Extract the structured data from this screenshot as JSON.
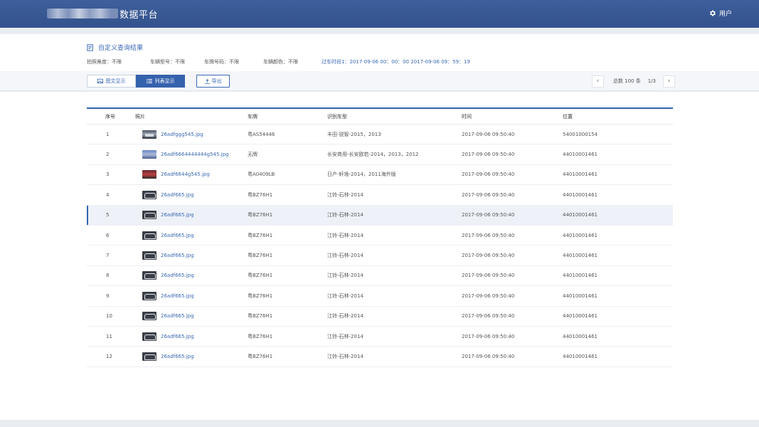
{
  "header": {
    "title": "数据平台",
    "user_label": "用户"
  },
  "query": {
    "title": "自定义查询结果",
    "filters": {
      "angle": "拍照角度：不限",
      "model": "车辆型号：不限",
      "plate": "车牌号码：不限",
      "color": "车辆颜色：不限",
      "time": "过车时段1：2017-09-06 00：00：00  2017-09-06  09：59：19"
    }
  },
  "toolbar": {
    "tab_graphic": "图文显示",
    "tab_list": "列表显示",
    "export": "导出",
    "total": "总数 100 条",
    "page": "1/3",
    "prev": "‹",
    "next": "›"
  },
  "table": {
    "columns": [
      "序号",
      "照片",
      "车牌",
      "识别车型",
      "时间",
      "位置"
    ],
    "rows": [
      {
        "idx": "1",
        "photo": "26adfggg545.jpg",
        "thumb": "car",
        "plate": "粤AS54446",
        "type": "丰田-锐智-2015，2013",
        "time": "2017-09-06   09:50:40",
        "loc": "54001000154"
      },
      {
        "idx": "2",
        "photo": "26adf6664444444g545.jpg",
        "thumb": "blue",
        "plate": "无牌",
        "type": "长安商用-长安欧若-2014，2013，2012",
        "time": "2017-09-06   09:50:40",
        "loc": "44010001461"
      },
      {
        "idx": "3",
        "photo": "26adf6644g545.jpg",
        "thumb": "red",
        "plate": "粤A0409LB",
        "type": "日产-轩逸-2014，2011海外版",
        "time": "2017-09-06   09:50:40",
        "loc": "44010001461"
      },
      {
        "idx": "4",
        "photo": "26adf665.jpg",
        "thumb": "logo",
        "plate": "粤BZ76H1",
        "type": "江铃-石林-2014",
        "time": "2017-09-06   09:50:40",
        "loc": "44010001461"
      },
      {
        "idx": "5",
        "photo": "26adf665.jpg",
        "thumb": "logo",
        "plate": "粤BZ76H1",
        "type": "江铃-石林-2014",
        "time": "2017-09-06   09:50:40",
        "loc": "44010001461"
      },
      {
        "idx": "6",
        "photo": "26adf665.jpg",
        "thumb": "logo",
        "plate": "粤BZ76H1",
        "type": "江铃-石林-2014",
        "time": "2017-09-06   09:50:40",
        "loc": "44010001461"
      },
      {
        "idx": "7",
        "photo": "26adf665.jpg",
        "thumb": "logo",
        "plate": "粤BZ76H1",
        "type": "江铃-石林-2014",
        "time": "2017-09-06   09:50:40",
        "loc": "44010001461"
      },
      {
        "idx": "8",
        "photo": "26adf665.jpg",
        "thumb": "logo",
        "plate": "粤BZ76H1",
        "type": "江铃-石林-2014",
        "time": "2017-09-06   09:50:40",
        "loc": "44010001461"
      },
      {
        "idx": "9",
        "photo": "26adf665.jpg",
        "thumb": "logo",
        "plate": "粤BZ76H1",
        "type": "江铃-石林-2014",
        "time": "2017-09-06   09:50:40",
        "loc": "44010001461"
      },
      {
        "idx": "10",
        "photo": "26adf665.jpg",
        "thumb": "logo",
        "plate": "粤BZ76H1",
        "type": "江铃-石林-2014",
        "time": "2017-09-06   09:50:40",
        "loc": "44010001461"
      },
      {
        "idx": "11",
        "photo": "26adf665.jpg",
        "thumb": "logo",
        "plate": "粤BZ76H1",
        "type": "江铃-石林-2014",
        "time": "2017-09-06   09:50:40",
        "loc": "44010001461"
      },
      {
        "idx": "12",
        "photo": "26adf665.jpg",
        "thumb": "logo",
        "plate": "粤BZ76H1",
        "type": "江铃-石林-2014",
        "time": "2017-09-06   09:50:40",
        "loc": "44010001461"
      }
    ],
    "highlighted_row": 5
  },
  "colors": {
    "header": "#33528c",
    "accent": "#3562ad",
    "link": "#3b6ab3"
  }
}
